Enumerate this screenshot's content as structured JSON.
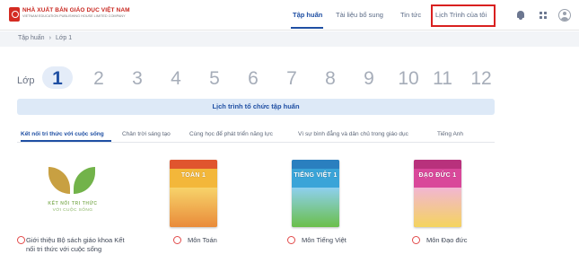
{
  "header": {
    "logo_title": "NHÀ XUẤT BẢN GIÁO DỤC VIỆT NAM",
    "logo_subtitle": "VIETNAM EDUCATION PUBLISHING HOUSE LIMITED COMPANY",
    "nav": [
      {
        "label": "Tập huấn",
        "active": true
      },
      {
        "label": "Tài liệu bổ sung",
        "active": false
      },
      {
        "label": "Tin tức",
        "active": false
      },
      {
        "label": "Lịch Trình của tôi",
        "active": false
      }
    ],
    "highlight_color": "#d9201f",
    "icons": [
      "bell-icon",
      "apps-grid-icon",
      "user-avatar-icon"
    ]
  },
  "breadcrumb": [
    "Tập huấn",
    "Lớp 1"
  ],
  "grades": {
    "label": "Lớp",
    "items": [
      "1",
      "2",
      "3",
      "4",
      "5",
      "6",
      "7",
      "8",
      "9",
      "10",
      "11",
      "12"
    ],
    "selected": "1"
  },
  "schedule_button": "Lịch trình tổ chức tập huấn",
  "tabs": [
    {
      "label": "Kết nối tri thức với cuộc sống",
      "active": true
    },
    {
      "label": "Chân trời sáng tạo",
      "active": false
    },
    {
      "label": "Cùng học để phát triển năng lực",
      "active": false
    },
    {
      "label": "Vì sự bình đẳng và dân chủ trong giáo dục",
      "active": false
    },
    {
      "label": "Tiếng Anh",
      "active": false
    }
  ],
  "books": [
    {
      "label_line1": "Giới thiệu Bộ sách giáo khoa Kết",
      "label_line2": "nối tri thức với cuộc sống",
      "logo_text1": "KẾT NỐI TRI THỨC",
      "logo_text2": "VỚI CUỘC SỐNG"
    },
    {
      "label": "Môn Toán",
      "cover_title": "TOÁN 1",
      "cover_color": "#f3b73a"
    },
    {
      "label": "Môn Tiếng Việt",
      "cover_title": "TIẾNG VIỆT 1",
      "cover_color": "#3aa4d8"
    },
    {
      "label": "Môn Đạo đức",
      "cover_title": "ĐẠO ĐỨC 1",
      "cover_color": "#d9489a"
    }
  ],
  "accent_color": "#1f4fa3"
}
